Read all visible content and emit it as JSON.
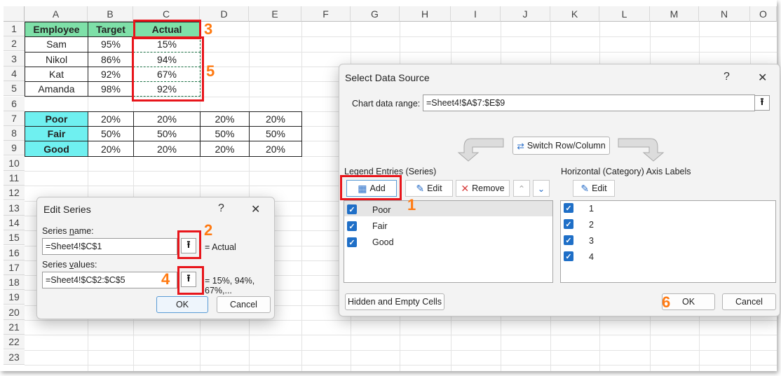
{
  "sheet": {
    "columns": [
      "A",
      "B",
      "C",
      "D",
      "E",
      "F",
      "G",
      "H",
      "I",
      "J",
      "K",
      "L",
      "M",
      "N",
      "O"
    ],
    "rows": [
      "1",
      "2",
      "3",
      "4",
      "5",
      "6",
      "7",
      "8",
      "9",
      "10",
      "11",
      "12",
      "13",
      "14",
      "15",
      "16",
      "17",
      "18",
      "19",
      "20",
      "21",
      "22",
      "23"
    ],
    "table1": {
      "headers": [
        "Employee",
        "Target",
        "Actual"
      ],
      "rows": [
        [
          "Sam",
          "95%",
          "15%"
        ],
        [
          "Nikol",
          "86%",
          "94%"
        ],
        [
          "Kat",
          "92%",
          "67%"
        ],
        [
          "Amanda",
          "98%",
          "92%"
        ]
      ]
    },
    "table2": {
      "rows": [
        [
          "Poor",
          "20%",
          "20%",
          "20%",
          "20%"
        ],
        [
          "Fair",
          "50%",
          "50%",
          "50%",
          "50%"
        ],
        [
          "Good",
          "20%",
          "20%",
          "20%",
          "20%"
        ]
      ]
    }
  },
  "steps": [
    "1",
    "2",
    "3",
    "4",
    "5",
    "6"
  ],
  "edit_series": {
    "title": "Edit Series",
    "help": "?",
    "close": "✕",
    "name_label_pre": "Series ",
    "name_label_key": "n",
    "name_label_post": "ame:",
    "name_value": "=Sheet4!$C$1",
    "name_preview": "= Actual",
    "values_label_pre": "Series ",
    "values_label_key": "v",
    "values_label_post": "alues:",
    "values_value": "=Sheet4!$C$2:$C$5",
    "values_preview": "= 15%, 94%, 67%,...",
    "ok": "OK",
    "cancel": "Cancel"
  },
  "select_data": {
    "title": "Select Data Source",
    "help": "?",
    "close": "✕",
    "range_label": "Chart data range:",
    "range_value": "=Sheet4!$A$7:$E$9",
    "switch_label": "Switch Row/Column",
    "legend_label": "Legend Entries (Series)",
    "axis_label": "Horizontal (Category) Axis Labels",
    "add": "Add",
    "edit": "Edit",
    "remove": "Remove",
    "axis_edit": "Edit",
    "series": [
      "Poor",
      "Fair",
      "Good"
    ],
    "categories": [
      "1",
      "2",
      "3",
      "4"
    ],
    "hidden_cells": "Hidden and Empty Cells",
    "ok": "OK",
    "cancel": "Cancel"
  },
  "colors": {
    "accent_red": "#e8151b",
    "step_orange": "#ff7a12",
    "header_green": "#7ee0a8",
    "category_cyan": "#6ff0f0",
    "checkbox_blue": "#1f6fc7"
  }
}
